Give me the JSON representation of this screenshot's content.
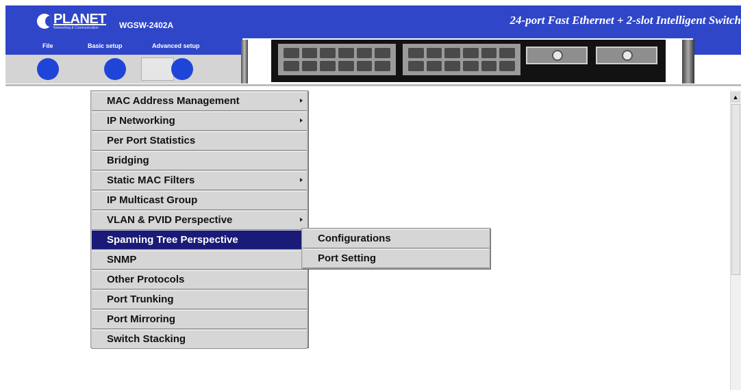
{
  "header": {
    "logo_text": "PLANET",
    "logo_tagline": "Networking & Communication",
    "model": "WGSW-2402A",
    "headline": "24-port Fast Ethernet + 2-slot Intelligent Switch"
  },
  "menubar": {
    "file_label": "File",
    "basic_label": "Basic setup",
    "advanced_label": "Advanced setup"
  },
  "menu": {
    "items": [
      {
        "label": "MAC Address Management",
        "has_submenu": true
      },
      {
        "label": "IP Networking",
        "has_submenu": true
      },
      {
        "label": "Per Port Statistics",
        "has_submenu": false
      },
      {
        "label": "Bridging",
        "has_submenu": false
      },
      {
        "label": "Static MAC Filters",
        "has_submenu": true
      },
      {
        "label": "IP Multicast Group",
        "has_submenu": false
      },
      {
        "label": "VLAN & PVID Perspective",
        "has_submenu": true
      },
      {
        "label": "Spanning Tree Perspective",
        "has_submenu": true,
        "active": true
      },
      {
        "label": "SNMP",
        "has_submenu": false
      },
      {
        "label": "Other Protocols",
        "has_submenu": false
      },
      {
        "label": "Port Trunking",
        "has_submenu": false
      },
      {
        "label": "Port Mirroring",
        "has_submenu": false
      },
      {
        "label": "Switch Stacking",
        "has_submenu": false
      }
    ]
  },
  "submenu": {
    "items": [
      {
        "label": "Configurations"
      },
      {
        "label": "Port Setting"
      }
    ]
  },
  "colors": {
    "banner_blue": "#2f46c8",
    "menu_highlight": "#1a1a78",
    "button_blue": "#1f45d8"
  }
}
